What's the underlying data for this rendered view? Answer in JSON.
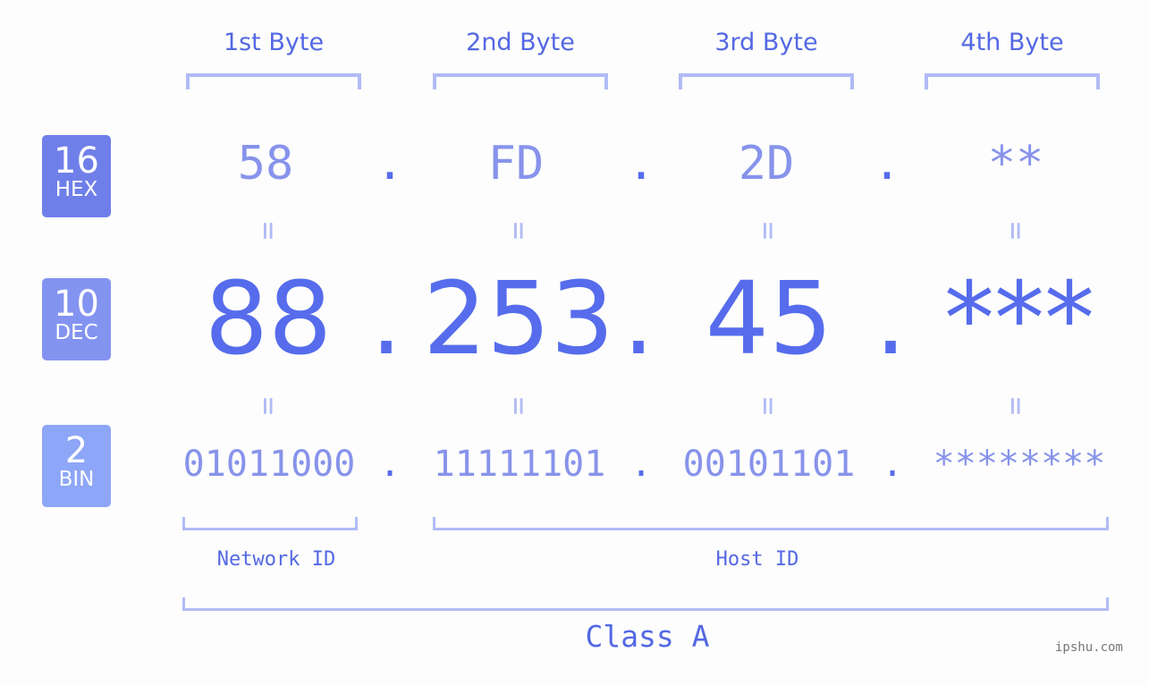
{
  "byte_headers": [
    "1st Byte",
    "2nd Byte",
    "3rd Byte",
    "4th Byte"
  ],
  "bases": [
    {
      "num": "16",
      "label": "HEX",
      "color": "#6f7fe9"
    },
    {
      "num": "10",
      "label": "DEC",
      "color": "#8393f0"
    },
    {
      "num": "2",
      "label": "BIN",
      "color": "#8ea6f7"
    }
  ],
  "hex": [
    "58",
    "FD",
    "2D",
    "**"
  ],
  "dec": [
    "88",
    "253",
    "45",
    "***"
  ],
  "bin": [
    "01011000",
    "11111101",
    "00101101",
    "********"
  ],
  "separator": ".",
  "equals": "=",
  "network_label": "Network ID",
  "host_label": "Host ID",
  "class_label": "Class A",
  "watermark": "ipshu.com",
  "colors": {
    "accent": "#566cec",
    "light": "#8793eb",
    "bracket": "#b1bbf6"
  }
}
